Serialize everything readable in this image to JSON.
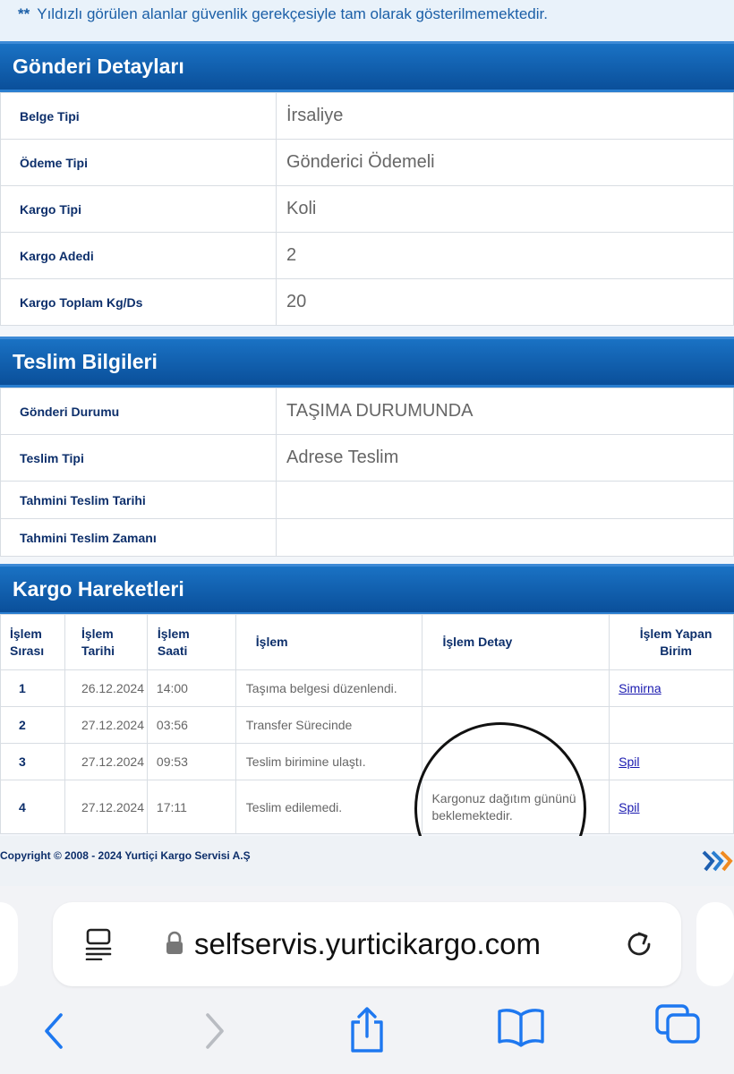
{
  "notice": {
    "stars": "**",
    "text": "Yıldızlı görülen alanlar güvenlik gerekçesiyle tam olarak gösterilmemektedir."
  },
  "shipment": {
    "title": "Gönderi Detayları",
    "rows": [
      {
        "label": "Belge Tipi",
        "value": "İrsaliye"
      },
      {
        "label": "Ödeme Tipi",
        "value": "Gönderici Ödemeli"
      },
      {
        "label": "Kargo Tipi",
        "value": "Koli"
      },
      {
        "label": "Kargo Adedi",
        "value": "2"
      },
      {
        "label": "Kargo Toplam Kg/Ds",
        "value": "20"
      }
    ]
  },
  "delivery": {
    "title": "Teslim Bilgileri",
    "rows": [
      {
        "label": "Gönderi Durumu",
        "value": "TAŞIMA DURUMUNDA"
      },
      {
        "label": "Teslim Tipi",
        "value": "Adrese Teslim"
      },
      {
        "label": "Tahmini Teslim Tarihi",
        "value": ""
      },
      {
        "label": "Tahmini Teslim Zamanı",
        "value": ""
      }
    ]
  },
  "movements": {
    "title": "Kargo Hareketleri",
    "headers": [
      "İşlem Sırası",
      "İşlem Tarihi",
      "İşlem Saati",
      "İşlem",
      "İşlem Detay",
      "İşlem Yapan Birim"
    ],
    "header_lines": [
      [
        "İşlem",
        "Sırası"
      ],
      [
        "İşlem",
        "Tarihi"
      ],
      [
        "İşlem",
        "Saati"
      ],
      [
        "İşlem"
      ],
      [
        "İşlem Detay"
      ],
      [
        "İşlem Yapan",
        "Birim"
      ]
    ],
    "rows": [
      {
        "no": "1",
        "date": "26.12.2024",
        "time": "14:00",
        "action": "Taşıma belgesi düzenlendi.",
        "detail_lines": [],
        "unit": "Simirna"
      },
      {
        "no": "2",
        "date": "27.12.2024",
        "time": "03:56",
        "action": "Transfer Sürecinde",
        "detail_lines": [],
        "unit": ""
      },
      {
        "no": "3",
        "date": "27.12.2024",
        "time": "09:53",
        "action": "Teslim birimine ulaştı.",
        "detail_lines": [],
        "unit": "Spil"
      },
      {
        "no": "4",
        "date": "27.12.2024",
        "time": "17:11",
        "action": "Teslim edilemedi.",
        "detail_lines": [
          "Kargonuz dağıtım gününü",
          "beklemektedir."
        ],
        "unit": "Spil"
      }
    ]
  },
  "footer": {
    "copyright": "Copyright © 2008 - 2024 Yurtiçi Kargo Servisi A.Ş"
  },
  "browser": {
    "url": "selfservis.yurticikargo.com",
    "icons": [
      "reader-icon",
      "lock-icon",
      "reload-icon",
      "back-icon",
      "forward-icon",
      "share-icon",
      "bookmarks-icon",
      "tabs-icon"
    ]
  },
  "colors": {
    "header_blue": "#0a4f9a",
    "label_navy": "#0d2f6b",
    "link_blue": "#1a1ab0",
    "safari_blue": "#1e78f0"
  }
}
